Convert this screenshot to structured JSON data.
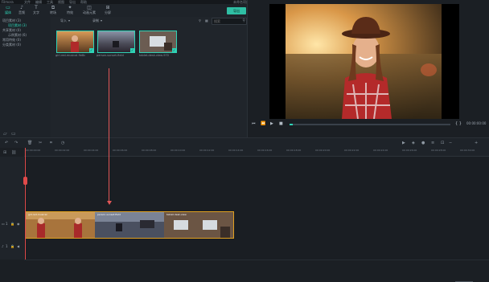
{
  "topbar": {
    "app_title": "Filmora",
    "menus": [
      "文件",
      "编辑",
      "工具",
      "视图",
      "导出",
      "帮助"
    ],
    "doc_title": "未命名项目"
  },
  "toolbar": {
    "tools": [
      {
        "label": "媒体",
        "icon": "folder-icon"
      },
      {
        "label": "音频",
        "icon": "music-icon"
      },
      {
        "label": "文字",
        "icon": "text-icon"
      },
      {
        "label": "转场",
        "icon": "transition-icon"
      },
      {
        "label": "特效",
        "icon": "effects-icon"
      },
      {
        "label": "动画元素",
        "icon": "elements-icon"
      },
      {
        "label": "分屏",
        "icon": "splitscreen-icon"
      }
    ],
    "export_label": "导出"
  },
  "sidebar": {
    "items": [
      {
        "label": "项目素材 (3)",
        "count": "",
        "sub": false,
        "active": false
      },
      {
        "label": "项目素材 (3)",
        "count": "",
        "sub": true,
        "active": true
      },
      {
        "label": "共享素材 (0)",
        "count": "",
        "sub": false,
        "active": false
      },
      {
        "label": "示例素材 (6)",
        "count": "",
        "sub": true,
        "active": false
      },
      {
        "label": "常用特效 (0)",
        "count": "",
        "sub": false,
        "active": false
      },
      {
        "label": "分类素材 (0)",
        "count": "",
        "sub": false,
        "active": false
      }
    ]
  },
  "library": {
    "import_label": "导入",
    "record_label": "录制",
    "search_placeholder": "搜索",
    "clips": [
      {
        "name": "girl-red-musical-9e8c"
      },
      {
        "name": "person-sunset-field"
      },
      {
        "name": "tablet-desk-view-970"
      }
    ]
  },
  "preview": {
    "timecode": "00:00:00:00",
    "progress": 0.02
  },
  "timeline": {
    "ruler_ticks": [
      "00:00:00:00",
      "00:00:02:00",
      "00:00:04:00",
      "00:00:06:00",
      "00:00:08:00",
      "00:00:10:00",
      "00:00:12:00",
      "00:00:14:00",
      "00:00:16:00",
      "00:00:18:00",
      "00:00:20:00",
      "00:00:22:00",
      "00:00:24:00",
      "00:00:26:00",
      "00:00:28:00",
      "00:00:30:00"
    ],
    "clip_labels": [
      "girl-red-musical",
      "person-sunset-field",
      "tablet-desk-view"
    ],
    "track_video": "1",
    "track_audio": "1"
  }
}
